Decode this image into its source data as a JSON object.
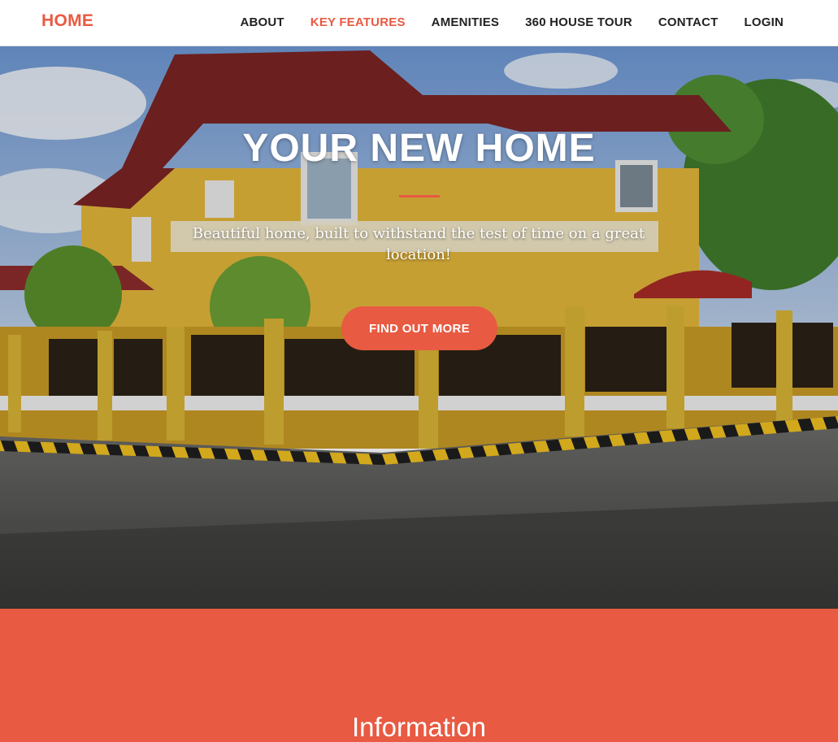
{
  "brand": {
    "label": "HOME"
  },
  "nav": {
    "items": [
      {
        "label": "ABOUT",
        "active": false
      },
      {
        "label": "KEY FEATURES",
        "active": true
      },
      {
        "label": "AMENITIES",
        "active": false
      },
      {
        "label": "360 HOUSE TOUR",
        "active": false
      },
      {
        "label": "CONTACT",
        "active": false
      },
      {
        "label": "LOGIN",
        "active": false
      }
    ]
  },
  "hero": {
    "title": "YOUR NEW HOME",
    "subtitle": "Beautiful home, built to withstand the test of time on a great location!",
    "button_label": "FIND OUT MORE"
  },
  "info": {
    "heading": "Information"
  },
  "colors": {
    "accent": "#e85a42",
    "nav_text": "#222222",
    "white": "#ffffff"
  }
}
